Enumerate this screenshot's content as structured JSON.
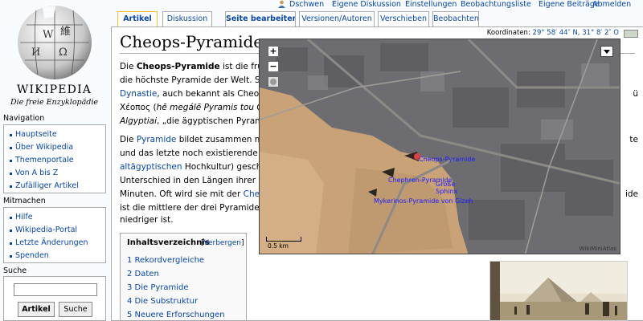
{
  "personal": {
    "user": "Dschwen",
    "talk": "Eigene Diskussion",
    "prefs": "Einstellungen",
    "watchlist": "Beobachtungsliste",
    "contribs": "Eigene Beiträge",
    "logout": "Abmelden"
  },
  "logo": {
    "wordmark": "Wikipedia",
    "tagline": "Die freie Enzyklopädie"
  },
  "tabs": [
    "Artikel",
    "Diskussion",
    "Seite bearbeiten",
    "Versionen/Autoren",
    "Verschieben",
    "Beobachten"
  ],
  "navigation": {
    "heading": "Navigation",
    "items": [
      "Hauptseite",
      "Über Wikipedia",
      "Themenportale",
      "Von A bis Z",
      "Zufälliger Artikel"
    ]
  },
  "participate": {
    "heading": "Mitmachen",
    "items": [
      "Hilfe",
      "Wikipedia-Portal",
      "Letzte Änderungen",
      "Spenden"
    ]
  },
  "search": {
    "heading": "Suche",
    "value": "",
    "go": "Artikel",
    "search": "Suche"
  },
  "article": {
    "title": "Cheops-Pyramide",
    "coords_label": "Koordinaten:",
    "coords_value": "29° 58′ 44″ N, 31° 8′ 2″ O",
    "p1": {
      "l1a": "Die ",
      "l1b": "Cheops-Pyramide",
      "l1c": " ist die frühe",
      "l2a": "die höchste Pyramide der Welt. Sie",
      "l3a": "Dynastie",
      "l3b": ", auch bekannt als Cheops",
      "l4a": "Χέοπος (",
      "l4b": "hē megálē Pyramis tou Ch",
      "l5a": "Algyptiai",
      "l5b": ", „die ägyptischen Pyramid"
    },
    "p2": {
      "l1a": "Die ",
      "l1b": "Pyramide",
      "l1c": " bildet zusammen mi",
      "l2a": "und das letzte noch existierende ",
      "l2b": "W",
      "l3a": "altägyptischen",
      "l3b": " Hochkultur) geschät",
      "l4": "Unterschied in den Längen ihrer vie",
      "l5a": "Minuten. Oft wird sie mit der ",
      "l5b": "Chep",
      "l6": "ist die mittlere der drei Pyramiden",
      "l7": "niedriger ist."
    },
    "right_edge": {
      "r1": "ü",
      "r2": "te",
      "r3": "ide"
    }
  },
  "toc": {
    "title": "Inhaltsverzeichnis",
    "toggle": "Verbergen",
    "items": [
      "1 Rekordvergleiche",
      "2 Daten",
      "3 Die Pyramide",
      "4 Die Substruktur",
      "5 Neuere Erforschungen"
    ]
  },
  "map": {
    "labels": [
      "Cheops-Pyramide",
      "Chephren-Pyramide",
      "Große Sphinx",
      "Mykerinos-Pyramide von Gizeh"
    ],
    "scale": "0.5 km",
    "credit": "WikiMiniAtlas",
    "colors": {
      "desert": "#c9a277",
      "city": "#6d6d71",
      "label": "#1a1aff",
      "marker": "#e04040"
    }
  }
}
